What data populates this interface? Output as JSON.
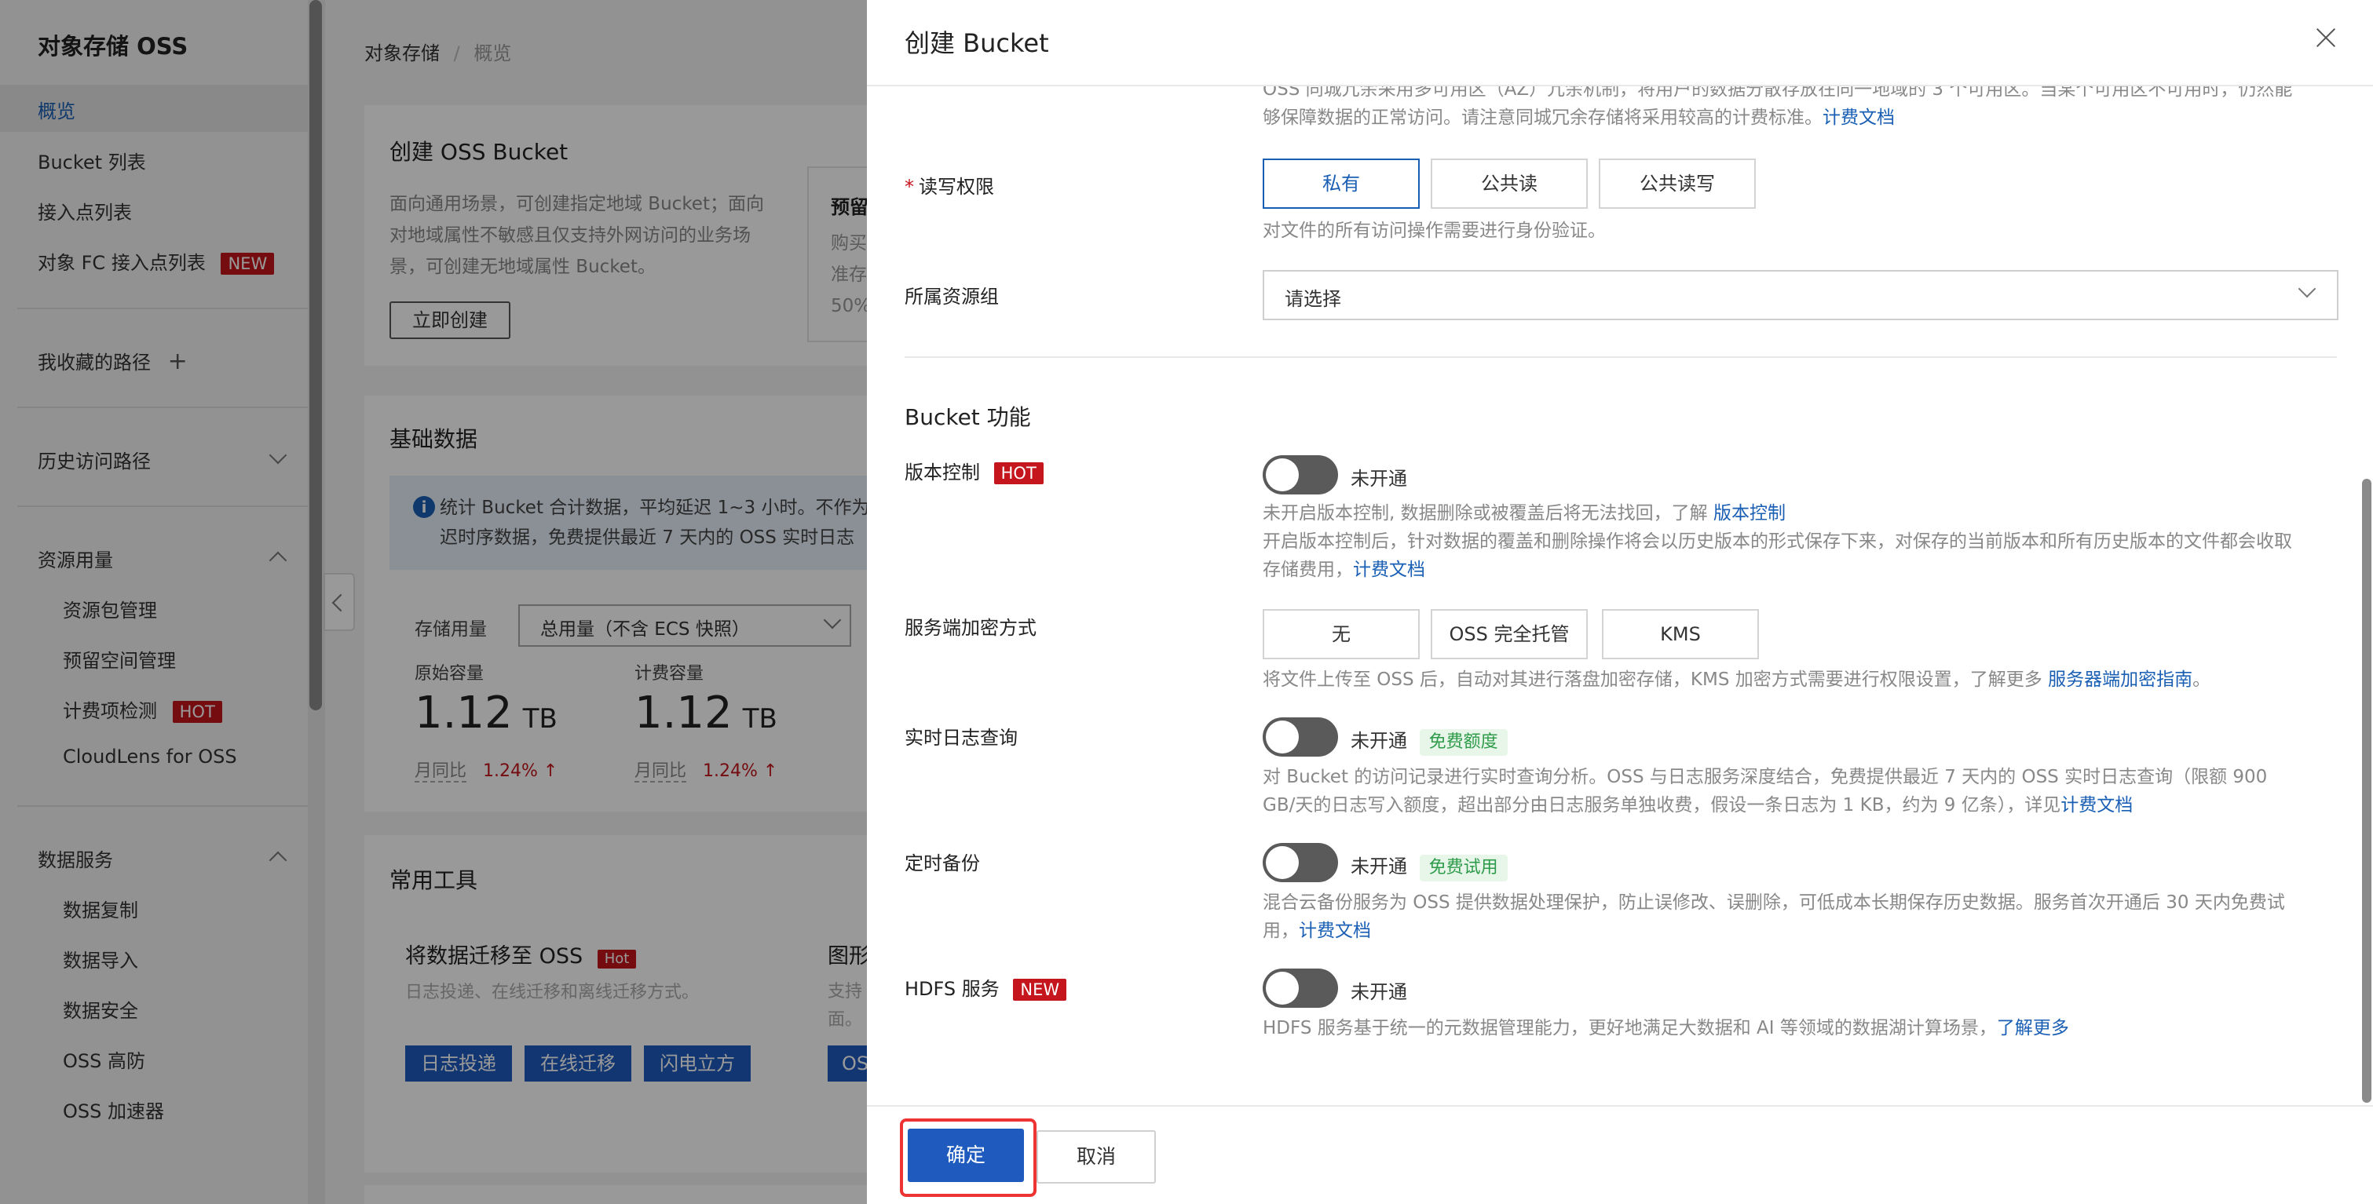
{
  "sidebar": {
    "title": "对象存储 OSS",
    "items": [
      {
        "label": "概览",
        "active": true
      },
      {
        "label": "Bucket 列表"
      },
      {
        "label": "接入点列表"
      },
      {
        "label": "对象 FC 接入点列表",
        "badge": "NEW"
      }
    ],
    "favorites": "我收藏的路径",
    "history": "历史访问路径",
    "resource_group": {
      "label": "资源用量",
      "items": [
        "资源包管理",
        "预留空间管理",
        "计费项检测",
        "CloudLens for OSS"
      ],
      "hot_badge": "HOT"
    },
    "data_services": {
      "label": "数据服务",
      "items": [
        "数据复制",
        "数据导入",
        "数据安全",
        "OSS 高防",
        "OSS 加速器"
      ]
    }
  },
  "main": {
    "breadcrumb": [
      "对象存储",
      "概览"
    ],
    "create_card": {
      "title": "创建 OSS Bucket",
      "desc": [
        "面向通用场景，可创建指定地域 Bucket；面向",
        "对地域属性不敏感且仅支持外网访问的业务场",
        "景，可创建无地域属性 Bucket。"
      ],
      "button": "立即创建",
      "side_title": "预留",
      "side_desc": [
        "购买",
        "准存",
        "50%"
      ]
    },
    "basic_data": {
      "title": "基础数据",
      "info": [
        "统计 Bucket 合计数据，平均延迟 1~3 小时。不作为",
        "迟时序数据，免费提供最近 7 天内的 OSS 实时日志"
      ],
      "storage_label": "存储用量",
      "storage_select": "总用量（不含 ECS 快照）",
      "metrics": [
        {
          "label": "原始容量",
          "value": "1.12",
          "unit": "TB",
          "compare": "月同比",
          "change": "1.24%"
        },
        {
          "label": "计费容量",
          "value": "1.12",
          "unit": "TB",
          "compare": "月同比",
          "change": "1.24%"
        }
      ]
    },
    "tools": {
      "title": "常用工具",
      "migrate_title": "将数据迁移至 OSS",
      "migrate_badge": "Hot",
      "migrate_desc": "日志投递、在线迁移和离线迁移方式。",
      "buttons": [
        "日志投递",
        "在线迁移",
        "闪电立方"
      ],
      "side_title": "图形",
      "side_desc": [
        "支持",
        "面。"
      ],
      "side_button": "OS"
    }
  },
  "drawer": {
    "title": "创建 Bucket",
    "top_desc": [
      "OSS 同城冗余采用多可用区（AZ）冗余机制，将用户的数据分散存放在同一地域的 3 个可用区。当某个可用区不可用时，仍然能",
      "够保障数据的正常访问。请注意同城冗余存储将采用较高的计费标准。"
    ],
    "top_link": "计费文档",
    "acl": {
      "label": "读写权限",
      "options": [
        "私有",
        "公共读",
        "公共读写"
      ],
      "selected": "私有",
      "desc": "对文件的所有访问操作需要进行身份验证。"
    },
    "resource_group": {
      "label": "所属资源组",
      "placeholder": "请选择"
    },
    "features_title": "Bucket 功能",
    "versioning": {
      "label": "版本控制",
      "badge": "HOT",
      "status": "未开通",
      "desc1": "未开启版本控制, 数据删除或被覆盖后将无法找回，了解 ",
      "link1": "版本控制",
      "desc2": "开启版本控制后，针对数据的覆盖和删除操作将会以历史版本的形式保存下来，对保存的当前版本和所有历史版本的文件都会收取",
      "desc3": "存储费用，",
      "link2": "计费文档"
    },
    "encryption": {
      "label": "服务端加密方式",
      "options": [
        "无",
        "OSS 完全托管",
        "KMS"
      ],
      "desc": "将文件上传至 OSS 后，自动对其进行落盘加密存储，KMS 加密方式需要进行权限设置，了解更多 ",
      "link": "服务器端加密指南",
      "tail": "。"
    },
    "realtime_log": {
      "label": "实时日志查询",
      "status": "未开通",
      "tag": "免费额度",
      "desc1": "对 Bucket 的访问记录进行实时查询分析。OSS 与日志服务深度结合，免费提供最近 7 天内的 OSS 实时日志查询（限额 900",
      "desc2": "GB/天的日志写入额度，超出部分由日志服务单独收费，假设一条日志为 1 KB，约为 9 亿条），详见",
      "link": "计费文档"
    },
    "backup": {
      "label": "定时备份",
      "status": "未开通",
      "tag": "免费试用",
      "desc1": "混合云备份服务为 OSS 提供数据处理保护，防止误修改、误删除，可低成本长期保存历史数据。服务首次开通后 30 天内免费试",
      "desc2": "用，",
      "link": "计费文档"
    },
    "hdfs": {
      "label": "HDFS 服务",
      "badge": "NEW",
      "status": "未开通",
      "desc": "HDFS 服务基于统一的元数据管理能力，更好地满足大数据和 AI 等领域的数据湖计算场景，",
      "link": "了解更多"
    },
    "footer": {
      "ok": "确定",
      "cancel": "取消"
    }
  }
}
